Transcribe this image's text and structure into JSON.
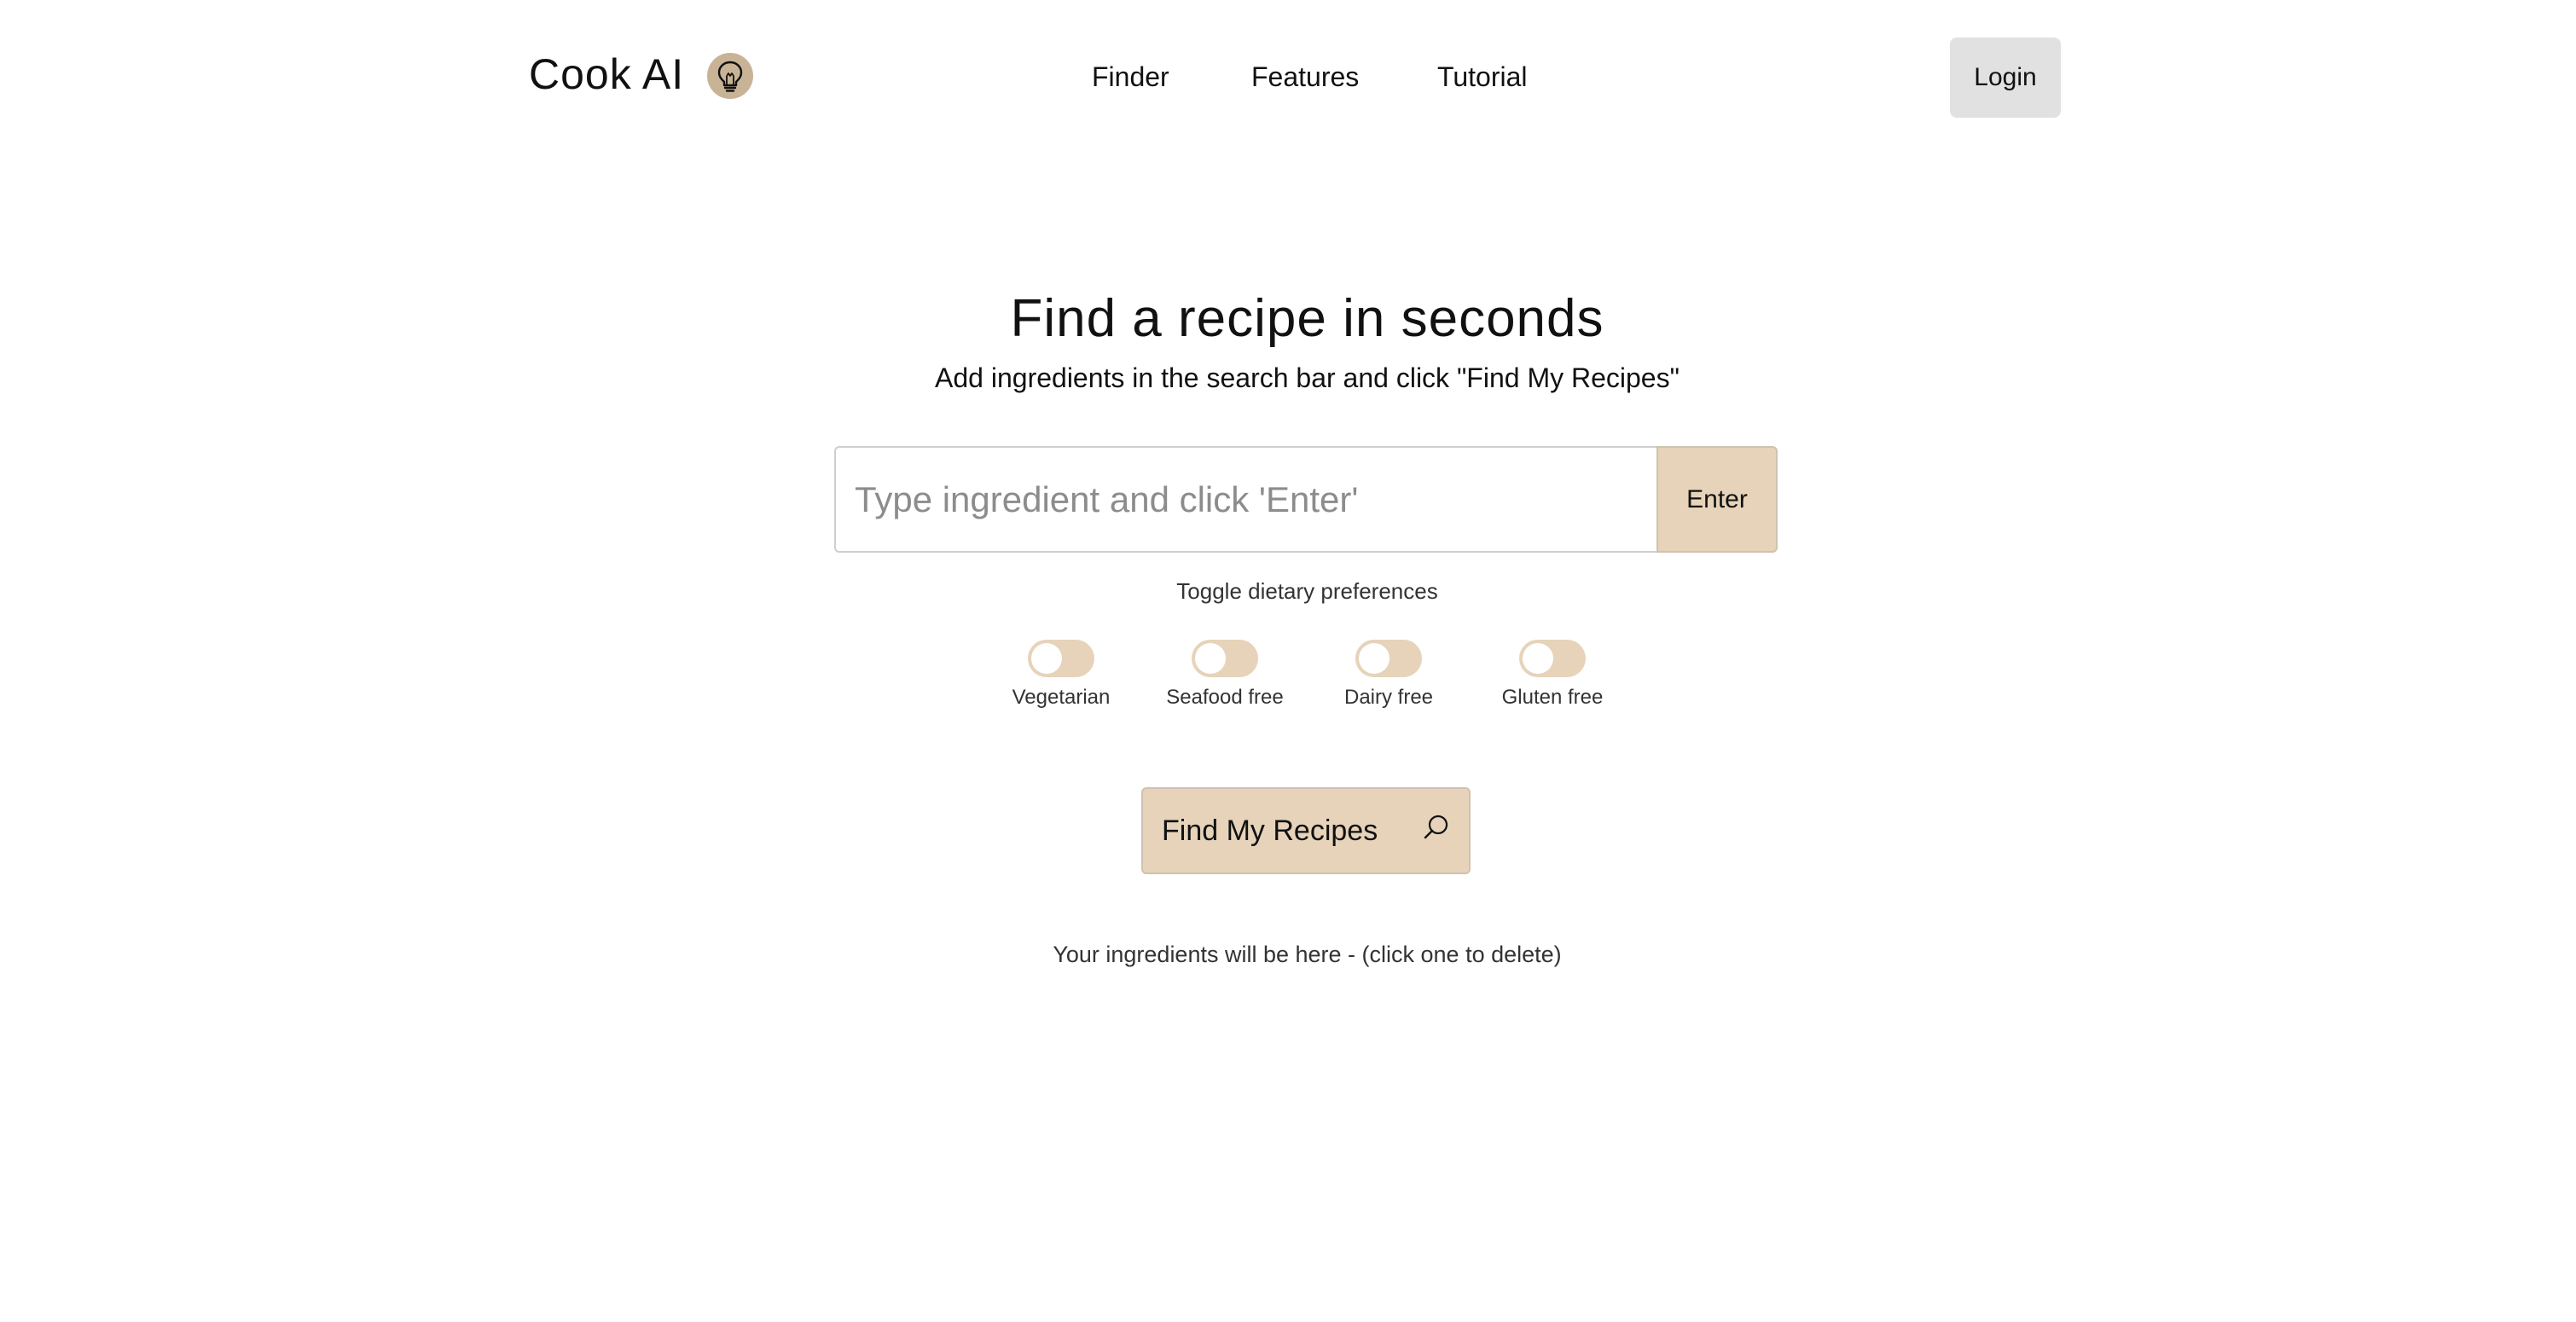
{
  "header": {
    "brand": "Cook AI",
    "brand_icon": "lightbulb-icon",
    "nav": [
      {
        "label": "Finder"
      },
      {
        "label": "Features"
      },
      {
        "label": "Tutorial"
      }
    ],
    "login_label": "Login"
  },
  "hero": {
    "title": "Find a recipe in seconds",
    "subtitle": "Add ingredients in the search bar and click \"Find My Recipes\""
  },
  "search": {
    "placeholder": "Type ingredient and click 'Enter'",
    "value": "",
    "enter_label": "Enter"
  },
  "preferences": {
    "caption": "Toggle dietary preferences",
    "toggles": [
      {
        "label": "Vegetarian",
        "on": false
      },
      {
        "label": "Seafood free",
        "on": false
      },
      {
        "label": "Dairy free",
        "on": false
      },
      {
        "label": "Gluten free",
        "on": false
      }
    ]
  },
  "find_button": {
    "label": "Find My Recipes",
    "icon": "search-icon"
  },
  "ingredients_note": "Your ingredients will be here - (click one to delete)",
  "colors": {
    "accent": "#e6d3ba",
    "login_bg": "#e1e1e1",
    "icon_bg": "#c8b396"
  }
}
